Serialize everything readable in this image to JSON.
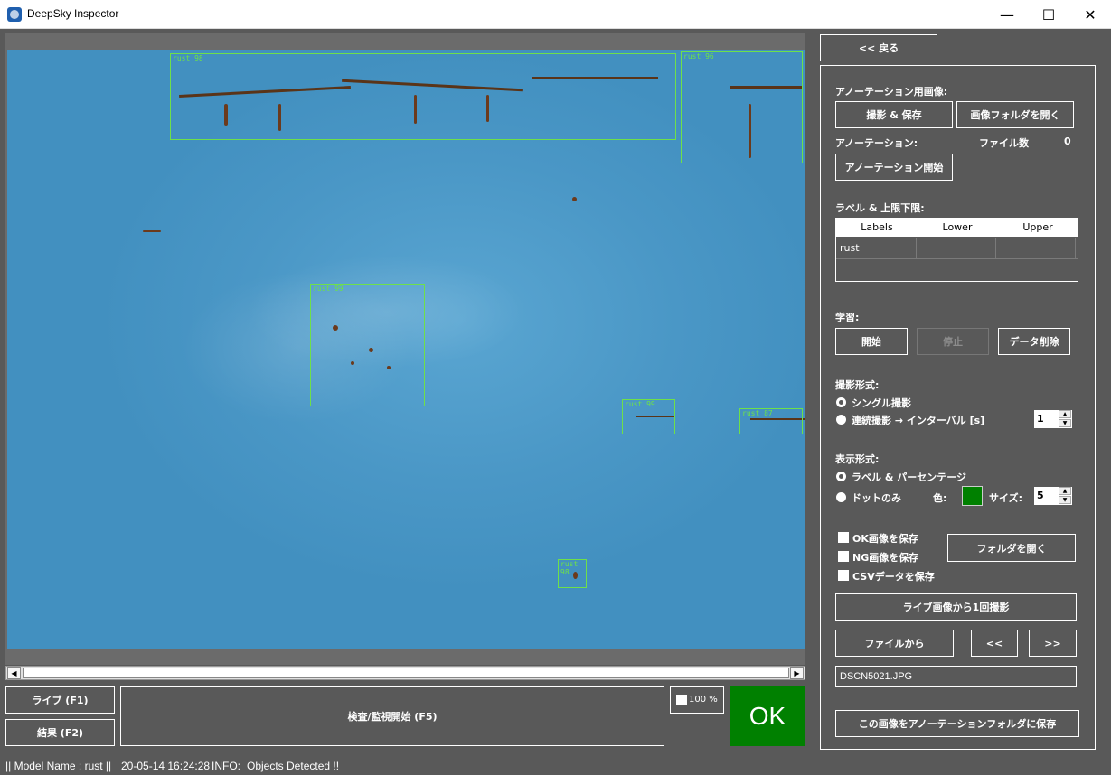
{
  "window": {
    "title": "DeepSky Inspector",
    "minimize": "—",
    "maximize": "☐",
    "close": "✕"
  },
  "image": {
    "detections": [
      {
        "label": "rust 98"
      },
      {
        "label": "rust 96"
      },
      {
        "label": "rust 99"
      },
      {
        "label": "rust 99"
      },
      {
        "label": "rust 87"
      },
      {
        "label": "rust 98"
      }
    ]
  },
  "bottom": {
    "live_button": "ライブ (F1)",
    "results_button": "結果 (F2)",
    "start_button": "検査/監視開始 (F5)",
    "zoom_label": "100 %",
    "result": "OK",
    "result_color": "#008000"
  },
  "status": {
    "model": "|| Model Name : rust ||",
    "timestamp": "20-05-14 16:24:28",
    "info_label": "INFO:",
    "info_text": "Objects Detected !!"
  },
  "panel": {
    "back_button": "<< 戻る",
    "annotation_image_label": "アノーテーション用画像:",
    "capture_save_button": "撮影 & 保存",
    "open_image_folder_button": "画像フォルダを開く",
    "annotation_label": "アノーテーション:",
    "file_count_label": "ファイル数",
    "file_count": "0",
    "start_annotation_button": "アノーテーション開始",
    "label_limits_label": "ラベル & 上限下限:",
    "table": {
      "headers": [
        "Labels",
        "Lower",
        "Upper"
      ],
      "rows": [
        [
          "rust",
          "",
          ""
        ]
      ]
    },
    "learning_label": "学習:",
    "learn_start_button": "開始",
    "learn_stop_button": "停止",
    "delete_data_button": "データ削除",
    "capture_mode_label": "撮影形式:",
    "single_capture": "シングル撮影",
    "continuous_capture": "連続撮影 → インターバル [s]",
    "interval_value": "1",
    "display_mode_label": "表示形式:",
    "label_percentage": "ラベル & パーセンテージ",
    "dot_only": "ドットのみ",
    "color_label": "色:",
    "dot_color": "#008000",
    "size_label": "サイズ:",
    "size_value": "5",
    "save_ok": "OK画像を保存",
    "save_ng": "NG画像を保存",
    "save_csv": "CSVデータを保存",
    "open_folder_button": "フォルダを開く",
    "capture_once_button": "ライブ画像から1回撮影",
    "from_file_button": "ファイルから",
    "prev_button": "<<",
    "next_button": ">>",
    "file_name": "DSCN5021.JPG",
    "save_to_annotation_button": "この画像をアノーテーションフォルダに保存"
  }
}
